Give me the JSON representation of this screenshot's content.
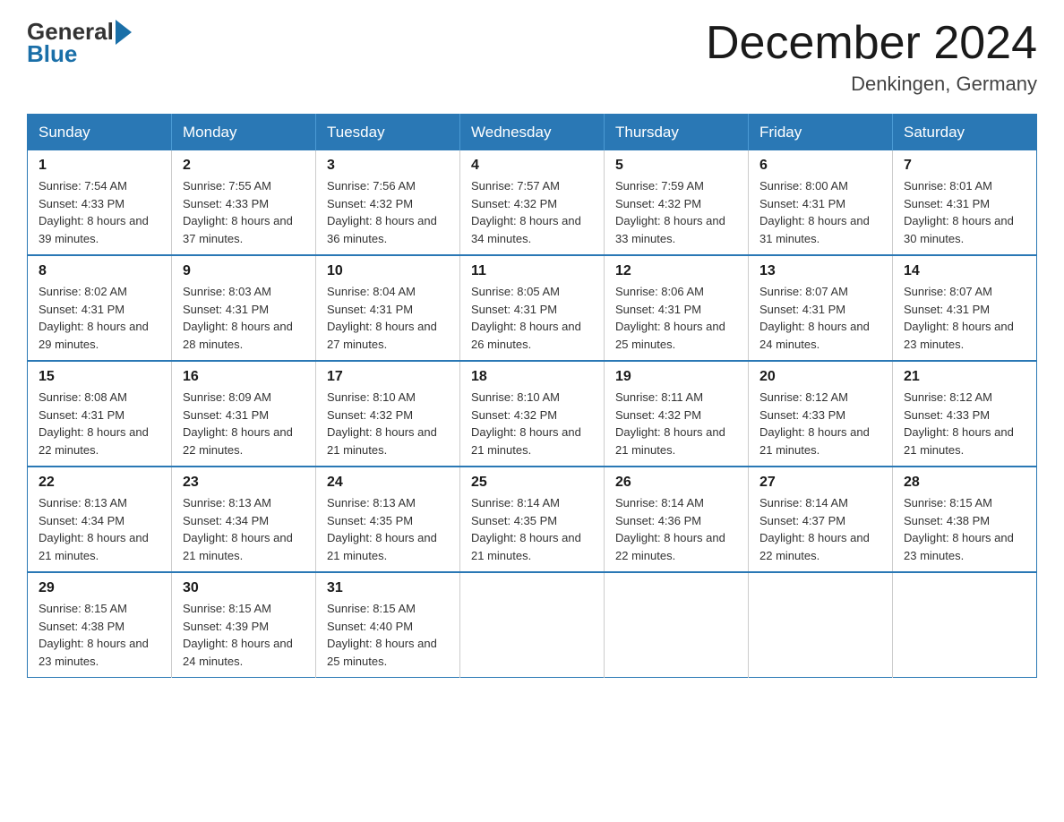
{
  "header": {
    "logo_general": "General",
    "logo_blue": "Blue",
    "month_title": "December 2024",
    "location": "Denkingen, Germany"
  },
  "weekdays": [
    "Sunday",
    "Monday",
    "Tuesday",
    "Wednesday",
    "Thursday",
    "Friday",
    "Saturday"
  ],
  "weeks": [
    [
      {
        "day": "1",
        "sunrise": "7:54 AM",
        "sunset": "4:33 PM",
        "daylight": "8 hours and 39 minutes."
      },
      {
        "day": "2",
        "sunrise": "7:55 AM",
        "sunset": "4:33 PM",
        "daylight": "8 hours and 37 minutes."
      },
      {
        "day": "3",
        "sunrise": "7:56 AM",
        "sunset": "4:32 PM",
        "daylight": "8 hours and 36 minutes."
      },
      {
        "day": "4",
        "sunrise": "7:57 AM",
        "sunset": "4:32 PM",
        "daylight": "8 hours and 34 minutes."
      },
      {
        "day": "5",
        "sunrise": "7:59 AM",
        "sunset": "4:32 PM",
        "daylight": "8 hours and 33 minutes."
      },
      {
        "day": "6",
        "sunrise": "8:00 AM",
        "sunset": "4:31 PM",
        "daylight": "8 hours and 31 minutes."
      },
      {
        "day": "7",
        "sunrise": "8:01 AM",
        "sunset": "4:31 PM",
        "daylight": "8 hours and 30 minutes."
      }
    ],
    [
      {
        "day": "8",
        "sunrise": "8:02 AM",
        "sunset": "4:31 PM",
        "daylight": "8 hours and 29 minutes."
      },
      {
        "day": "9",
        "sunrise": "8:03 AM",
        "sunset": "4:31 PM",
        "daylight": "8 hours and 28 minutes."
      },
      {
        "day": "10",
        "sunrise": "8:04 AM",
        "sunset": "4:31 PM",
        "daylight": "8 hours and 27 minutes."
      },
      {
        "day": "11",
        "sunrise": "8:05 AM",
        "sunset": "4:31 PM",
        "daylight": "8 hours and 26 minutes."
      },
      {
        "day": "12",
        "sunrise": "8:06 AM",
        "sunset": "4:31 PM",
        "daylight": "8 hours and 25 minutes."
      },
      {
        "day": "13",
        "sunrise": "8:07 AM",
        "sunset": "4:31 PM",
        "daylight": "8 hours and 24 minutes."
      },
      {
        "day": "14",
        "sunrise": "8:07 AM",
        "sunset": "4:31 PM",
        "daylight": "8 hours and 23 minutes."
      }
    ],
    [
      {
        "day": "15",
        "sunrise": "8:08 AM",
        "sunset": "4:31 PM",
        "daylight": "8 hours and 22 minutes."
      },
      {
        "day": "16",
        "sunrise": "8:09 AM",
        "sunset": "4:31 PM",
        "daylight": "8 hours and 22 minutes."
      },
      {
        "day": "17",
        "sunrise": "8:10 AM",
        "sunset": "4:32 PM",
        "daylight": "8 hours and 21 minutes."
      },
      {
        "day": "18",
        "sunrise": "8:10 AM",
        "sunset": "4:32 PM",
        "daylight": "8 hours and 21 minutes."
      },
      {
        "day": "19",
        "sunrise": "8:11 AM",
        "sunset": "4:32 PM",
        "daylight": "8 hours and 21 minutes."
      },
      {
        "day": "20",
        "sunrise": "8:12 AM",
        "sunset": "4:33 PM",
        "daylight": "8 hours and 21 minutes."
      },
      {
        "day": "21",
        "sunrise": "8:12 AM",
        "sunset": "4:33 PM",
        "daylight": "8 hours and 21 minutes."
      }
    ],
    [
      {
        "day": "22",
        "sunrise": "8:13 AM",
        "sunset": "4:34 PM",
        "daylight": "8 hours and 21 minutes."
      },
      {
        "day": "23",
        "sunrise": "8:13 AM",
        "sunset": "4:34 PM",
        "daylight": "8 hours and 21 minutes."
      },
      {
        "day": "24",
        "sunrise": "8:13 AM",
        "sunset": "4:35 PM",
        "daylight": "8 hours and 21 minutes."
      },
      {
        "day": "25",
        "sunrise": "8:14 AM",
        "sunset": "4:35 PM",
        "daylight": "8 hours and 21 minutes."
      },
      {
        "day": "26",
        "sunrise": "8:14 AM",
        "sunset": "4:36 PM",
        "daylight": "8 hours and 22 minutes."
      },
      {
        "day": "27",
        "sunrise": "8:14 AM",
        "sunset": "4:37 PM",
        "daylight": "8 hours and 22 minutes."
      },
      {
        "day": "28",
        "sunrise": "8:15 AM",
        "sunset": "4:38 PM",
        "daylight": "8 hours and 23 minutes."
      }
    ],
    [
      {
        "day": "29",
        "sunrise": "8:15 AM",
        "sunset": "4:38 PM",
        "daylight": "8 hours and 23 minutes."
      },
      {
        "day": "30",
        "sunrise": "8:15 AM",
        "sunset": "4:39 PM",
        "daylight": "8 hours and 24 minutes."
      },
      {
        "day": "31",
        "sunrise": "8:15 AM",
        "sunset": "4:40 PM",
        "daylight": "8 hours and 25 minutes."
      },
      null,
      null,
      null,
      null
    ]
  ],
  "labels": {
    "sunrise": "Sunrise: ",
    "sunset": "Sunset: ",
    "daylight": "Daylight: "
  }
}
